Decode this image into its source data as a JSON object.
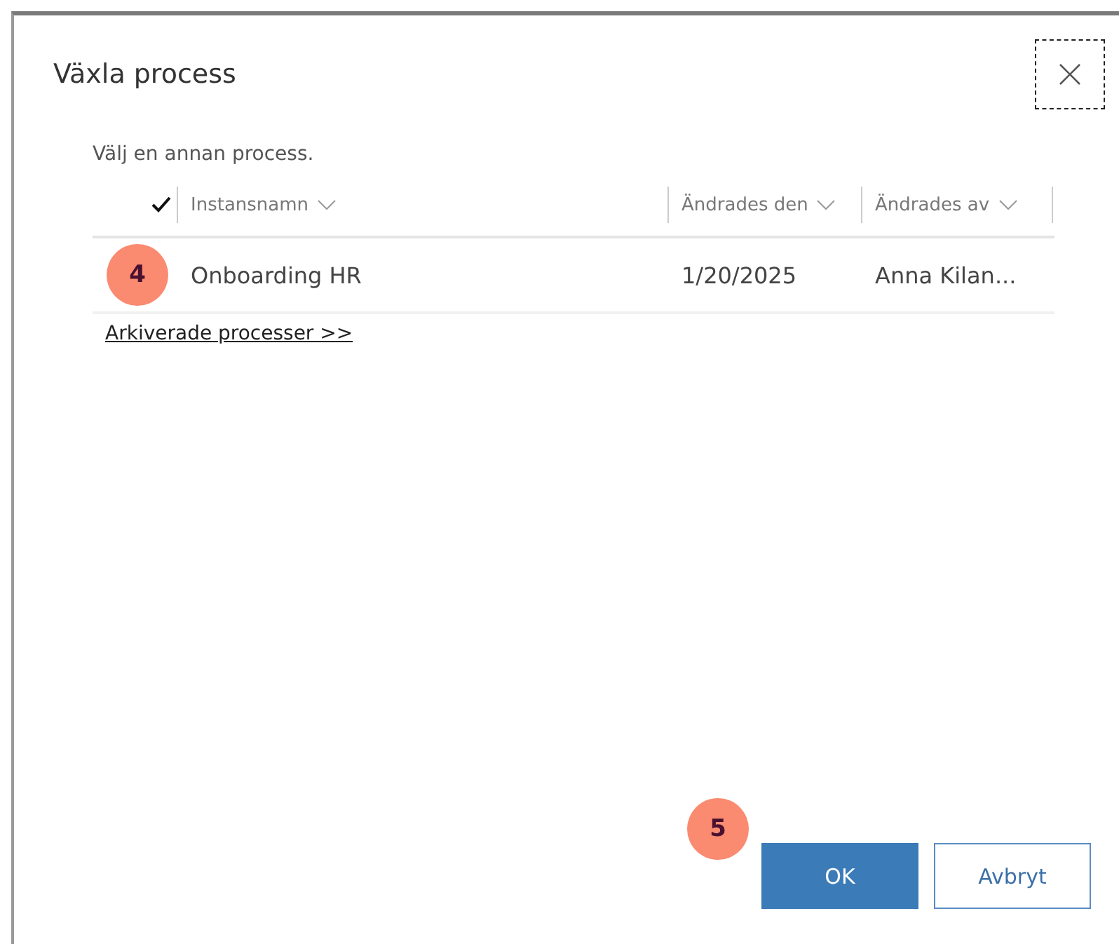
{
  "dialog": {
    "title": "Växla process",
    "instruction": "Välj en annan process.",
    "table": {
      "columns": [
        "Instansnamn",
        "Ändrades den",
        "Ändrades av"
      ],
      "rows": [
        {
          "cells": [
            "Onboarding HR",
            "1/20/2025",
            "Anna Kilan..."
          ]
        }
      ]
    },
    "link": "Arkiverade processer >>",
    "buttons": [
      {
        "label": "OK",
        "kind": "primary"
      },
      {
        "label": "Avbryt",
        "kind": "secondary"
      }
    ]
  },
  "callouts": [
    {
      "text": "4"
    },
    {
      "text": "5"
    }
  ]
}
